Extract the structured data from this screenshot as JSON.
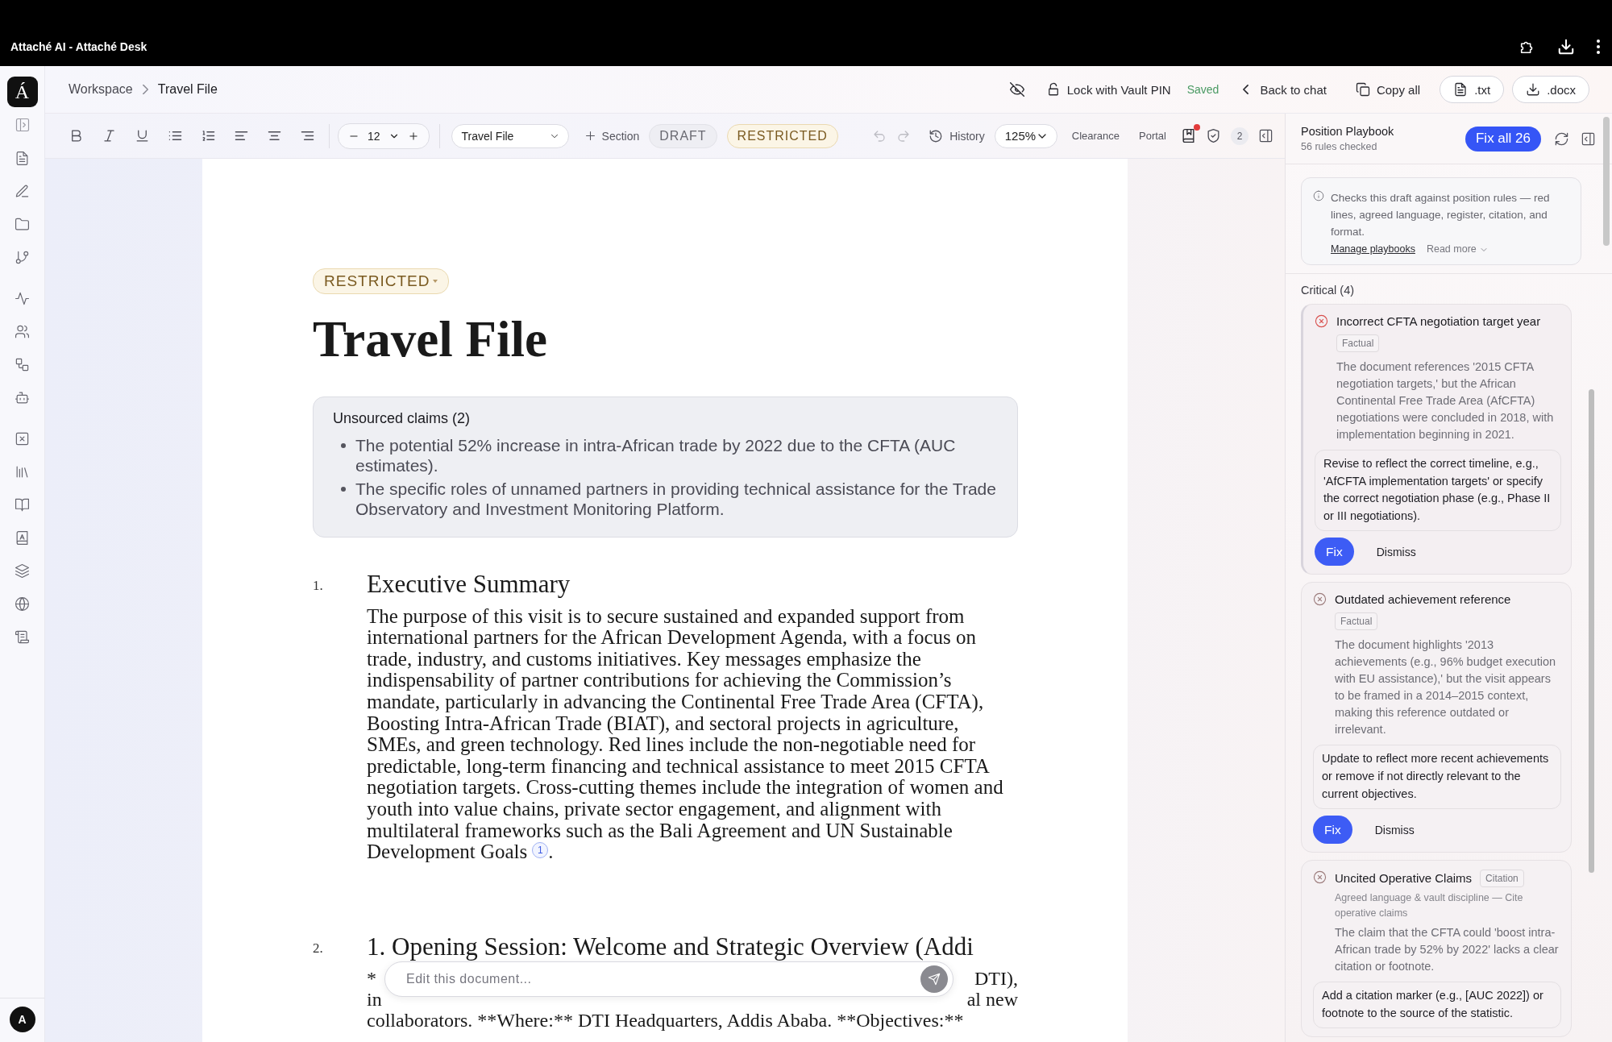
{
  "window": {
    "title": "Attaché AI - Attaché Desk"
  },
  "rail": {
    "logo": "Á",
    "avatar": "A"
  },
  "breadcrumb": [
    "Workspace",
    "Travel File"
  ],
  "header": {
    "lock": "Lock with Vault PIN",
    "status": "Saved",
    "back": "Back to chat",
    "copy": "Copy all",
    "exports": [
      ".txt",
      ".docx"
    ]
  },
  "toolbar": {
    "font_size": "12",
    "style": "Travel File",
    "add_section": "Section",
    "classifications": [
      {
        "label": "DRAFT",
        "selected": false
      },
      {
        "label": "RESTRICTED",
        "selected": true
      }
    ],
    "undo": {
      "disabled": true
    },
    "redo": {
      "disabled": true
    },
    "history": "History",
    "zoom": "125%",
    "links": [
      "Clearance",
      "Portal"
    ],
    "unread": true,
    "count": "2"
  },
  "document": {
    "classification": "RESTRICTED",
    "title": "Travel File",
    "callout": {
      "title": "Unsourced claims (2)",
      "items": [
        "The potential 52% increase in intra-African trade by 2022 due to the CFTA (AUC estimates).",
        "The specific roles of unnamed partners in providing technical assistance for the Trade Observatory and Investment Monitoring Platform."
      ]
    },
    "sections": [
      {
        "number": "1.",
        "heading": "Executive Summary",
        "body": "The purpose of this visit is to secure sustained and expanded support from international partners for the African Development Agenda, with a focus on trade, industry, and customs initiatives. Key messages emphasize the indispensability of partner contributions for achieving the Commission’s mandate, particularly in advancing the Continental Free Trade Area (CFTA), Boosting Intra-African Trade (BIAT), and sectoral projects in agriculture, SMEs, and green technology. Red lines include the non-negotiable need for predictable, long-term financing and technical assistance to meet 2015 CFTA negotiation targets. Cross-cutting themes include the integration of women and youth into value chains, private sector engagement, and alignment with multilateral frameworks such as the Bali Agreement and UN Sustainable Development Goals",
        "footnote": "1",
        "end": "."
      },
      {
        "number": "2.",
        "heading": "1. Opening Session: Welcome and Strategic Overview (Addi",
        "lines": [
          {
            "left": "*",
            "right": "DTI),"
          },
          {
            "left": "in",
            "right": "al new"
          },
          {
            "left": "collaborators. **Where:** DTI Headquarters, Addis Ababa. **Objectives:**"
          }
        ]
      }
    ]
  },
  "chat": {
    "placeholder": "Edit this document..."
  },
  "panel": {
    "title": "Position Playbook",
    "subtitle": "56 rules checked",
    "fix_all": "Fix all 26",
    "info": {
      "text": "Checks this draft against position rules — red lines, agreed language, register, citation, and format.",
      "link": "Manage playbooks",
      "more": "Read more"
    },
    "group": "Critical (4)",
    "issues": [
      {
        "title": "Incorrect CFTA negotiation target year",
        "tag": "Factual",
        "active": true,
        "description": "The document references '2015 CFTA negotiation targets,' but the African Continental Free Trade Area (AfCFTA) negotiations were concluded in 2018, with implementation beginning in 2021.",
        "suggestion": "Revise to reflect the correct timeline, e.g., 'AfCFTA implementation targets' or specify the correct negotiation phase (e.g., Phase II or III negotiations).",
        "actions": [
          "Fix",
          "Dismiss"
        ]
      },
      {
        "title": "Outdated achievement reference",
        "tag": "Factual",
        "active": false,
        "description": "The document highlights '2013 achievements (e.g., 96% budget execution with EU assistance),' but the visit appears to be framed in a 2014–2015 context, making this reference outdated or irrelevant.",
        "suggestion": "Update to reflect more recent achievements or remove if not directly relevant to the current objectives.",
        "actions": [
          "Fix",
          "Dismiss"
        ]
      },
      {
        "title": "Uncited Operative Claims",
        "tag": "Citation",
        "rule": "Agreed language & vault discipline — Cite operative claims",
        "active": false,
        "description": "The claim that the CFTA could 'boost intra-African trade by 52% by 2022' lacks a clear citation or footnote.",
        "suggestion": "Add a citation marker (e.g., [AUC 2022]) or footnote to the source of the statistic."
      }
    ]
  }
}
